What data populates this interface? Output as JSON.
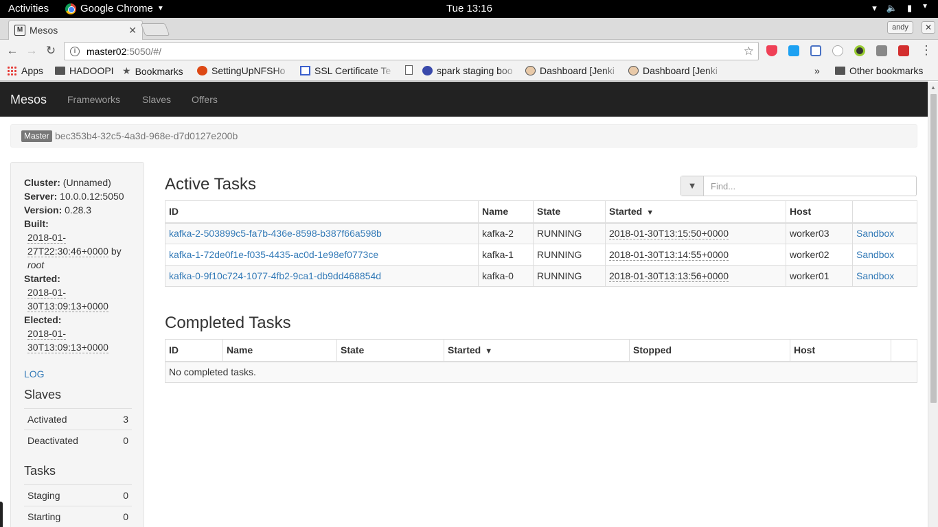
{
  "system": {
    "activities": "Activities",
    "app_name": "Google Chrome",
    "clock": "Tue 13:16"
  },
  "browser": {
    "tab_title": "Mesos",
    "tab_favicon": "M",
    "profile": "andy",
    "url_host": "master02",
    "url_rest": ":5050/#/",
    "bookmarks": [
      {
        "label": "Apps",
        "icon": "apps-grid-icon"
      },
      {
        "label": "HADOOPI",
        "icon": "folder-icon"
      },
      {
        "label": "Bookmarks",
        "icon": "star-icon"
      },
      {
        "label": "SettingUpNFSHo",
        "icon": "ubuntu-icon"
      },
      {
        "label": "SSL Certificate Te",
        "icon": "ssl-icon"
      },
      {
        "label": "",
        "icon": "page-icon"
      },
      {
        "label": "spark staging boo",
        "icon": "circle-icon"
      },
      {
        "label": "Dashboard [Jenki",
        "icon": "jenkins-icon"
      },
      {
        "label": "Dashboard [Jenki",
        "icon": "jenkins-icon"
      }
    ],
    "more_bookmarks": "»",
    "other_bookmarks": "Other bookmarks"
  },
  "navbar": {
    "brand": "Mesos",
    "links": [
      "Frameworks",
      "Slaves",
      "Offers"
    ]
  },
  "master": {
    "label": "Master",
    "id": "bec353b4-32c5-4a3d-968e-d7d0127e200b"
  },
  "sidebar": {
    "cluster_label": "Cluster:",
    "cluster_value": "(Unnamed)",
    "server_label": "Server:",
    "server_value": "10.0.0.12:5050",
    "version_label": "Version:",
    "version_value": "0.28.3",
    "built_label": "Built:",
    "built_line1": "2018-01-",
    "built_line2": "27T22:30:46+0000",
    "built_by": "by",
    "built_user": "root",
    "started_label": "Started:",
    "started_line1": "2018-01-",
    "started_line2": "30T13:09:13+0000",
    "elected_label": "Elected:",
    "elected_line1": "2018-01-",
    "elected_line2": "30T13:09:13+0000",
    "log_link": "LOG",
    "slaves_heading": "Slaves",
    "slaves": [
      {
        "label": "Activated",
        "value": "3"
      },
      {
        "label": "Deactivated",
        "value": "0"
      }
    ],
    "tasks_heading": "Tasks",
    "tasks": [
      {
        "label": "Staging",
        "value": "0"
      },
      {
        "label": "Starting",
        "value": "0"
      }
    ]
  },
  "active_tasks": {
    "heading": "Active Tasks",
    "find_placeholder": "Find...",
    "columns": [
      "ID",
      "Name",
      "State",
      "Started",
      "Host",
      ""
    ],
    "sort_indicator": "▼",
    "rows": [
      {
        "id": "kafka-2-503899c5-fa7b-436e-8598-b387f66a598b",
        "name": "kafka-2",
        "state": "RUNNING",
        "started": "2018-01-30T13:15:50+0000",
        "host": "worker03",
        "link": "Sandbox"
      },
      {
        "id": "kafka-1-72de0f1e-f035-4435-ac0d-1e98ef0773ce",
        "name": "kafka-1",
        "state": "RUNNING",
        "started": "2018-01-30T13:14:55+0000",
        "host": "worker02",
        "link": "Sandbox"
      },
      {
        "id": "kafka-0-9f10c724-1077-4fb2-9ca1-db9dd468854d",
        "name": "kafka-0",
        "state": "RUNNING",
        "started": "2018-01-30T13:13:56+0000",
        "host": "worker01",
        "link": "Sandbox"
      }
    ]
  },
  "completed_tasks": {
    "heading": "Completed Tasks",
    "columns": [
      "ID",
      "Name",
      "State",
      "Started",
      "Stopped",
      "Host",
      ""
    ],
    "sort_indicator": "▼",
    "empty_message": "No completed tasks."
  }
}
